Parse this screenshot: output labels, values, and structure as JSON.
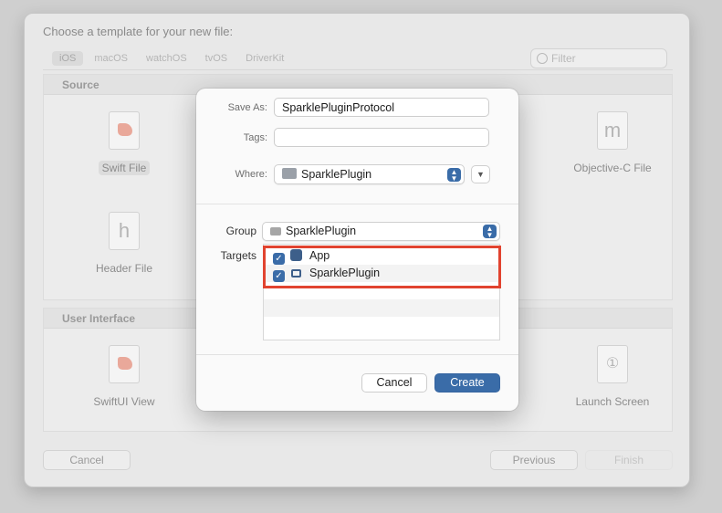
{
  "background": {
    "title": "Choose a template for your new file:",
    "platform_tabs": [
      "iOS",
      "macOS",
      "watchOS",
      "tvOS",
      "DriverKit"
    ],
    "filter_placeholder": "Filter",
    "sections": [
      {
        "name": "Source",
        "templates": [
          "Swift File",
          "Objective-C File",
          "Header File"
        ]
      },
      {
        "name": "User Interface",
        "templates": [
          "SwiftUI View",
          "Launch Screen"
        ]
      }
    ],
    "buttons": {
      "cancel": "Cancel",
      "previous": "Previous",
      "finish": "Finish"
    }
  },
  "dialog": {
    "save_as_label": "Save As:",
    "save_as_value": "SparklePluginProtocol",
    "tags_label": "Tags:",
    "tags_value": "",
    "where_label": "Where:",
    "where_value": "SparklePlugin",
    "group_label": "Group",
    "group_value": "SparklePlugin",
    "targets_label": "Targets",
    "targets": [
      {
        "name": "App",
        "checked": true,
        "icon": "app-icon"
      },
      {
        "name": "SparklePlugin",
        "checked": true,
        "icon": "plugin-icon"
      }
    ],
    "buttons": {
      "cancel": "Cancel",
      "create": "Create"
    }
  },
  "colors": {
    "accent": "#3a6ca8",
    "highlight": "#e1432f"
  }
}
